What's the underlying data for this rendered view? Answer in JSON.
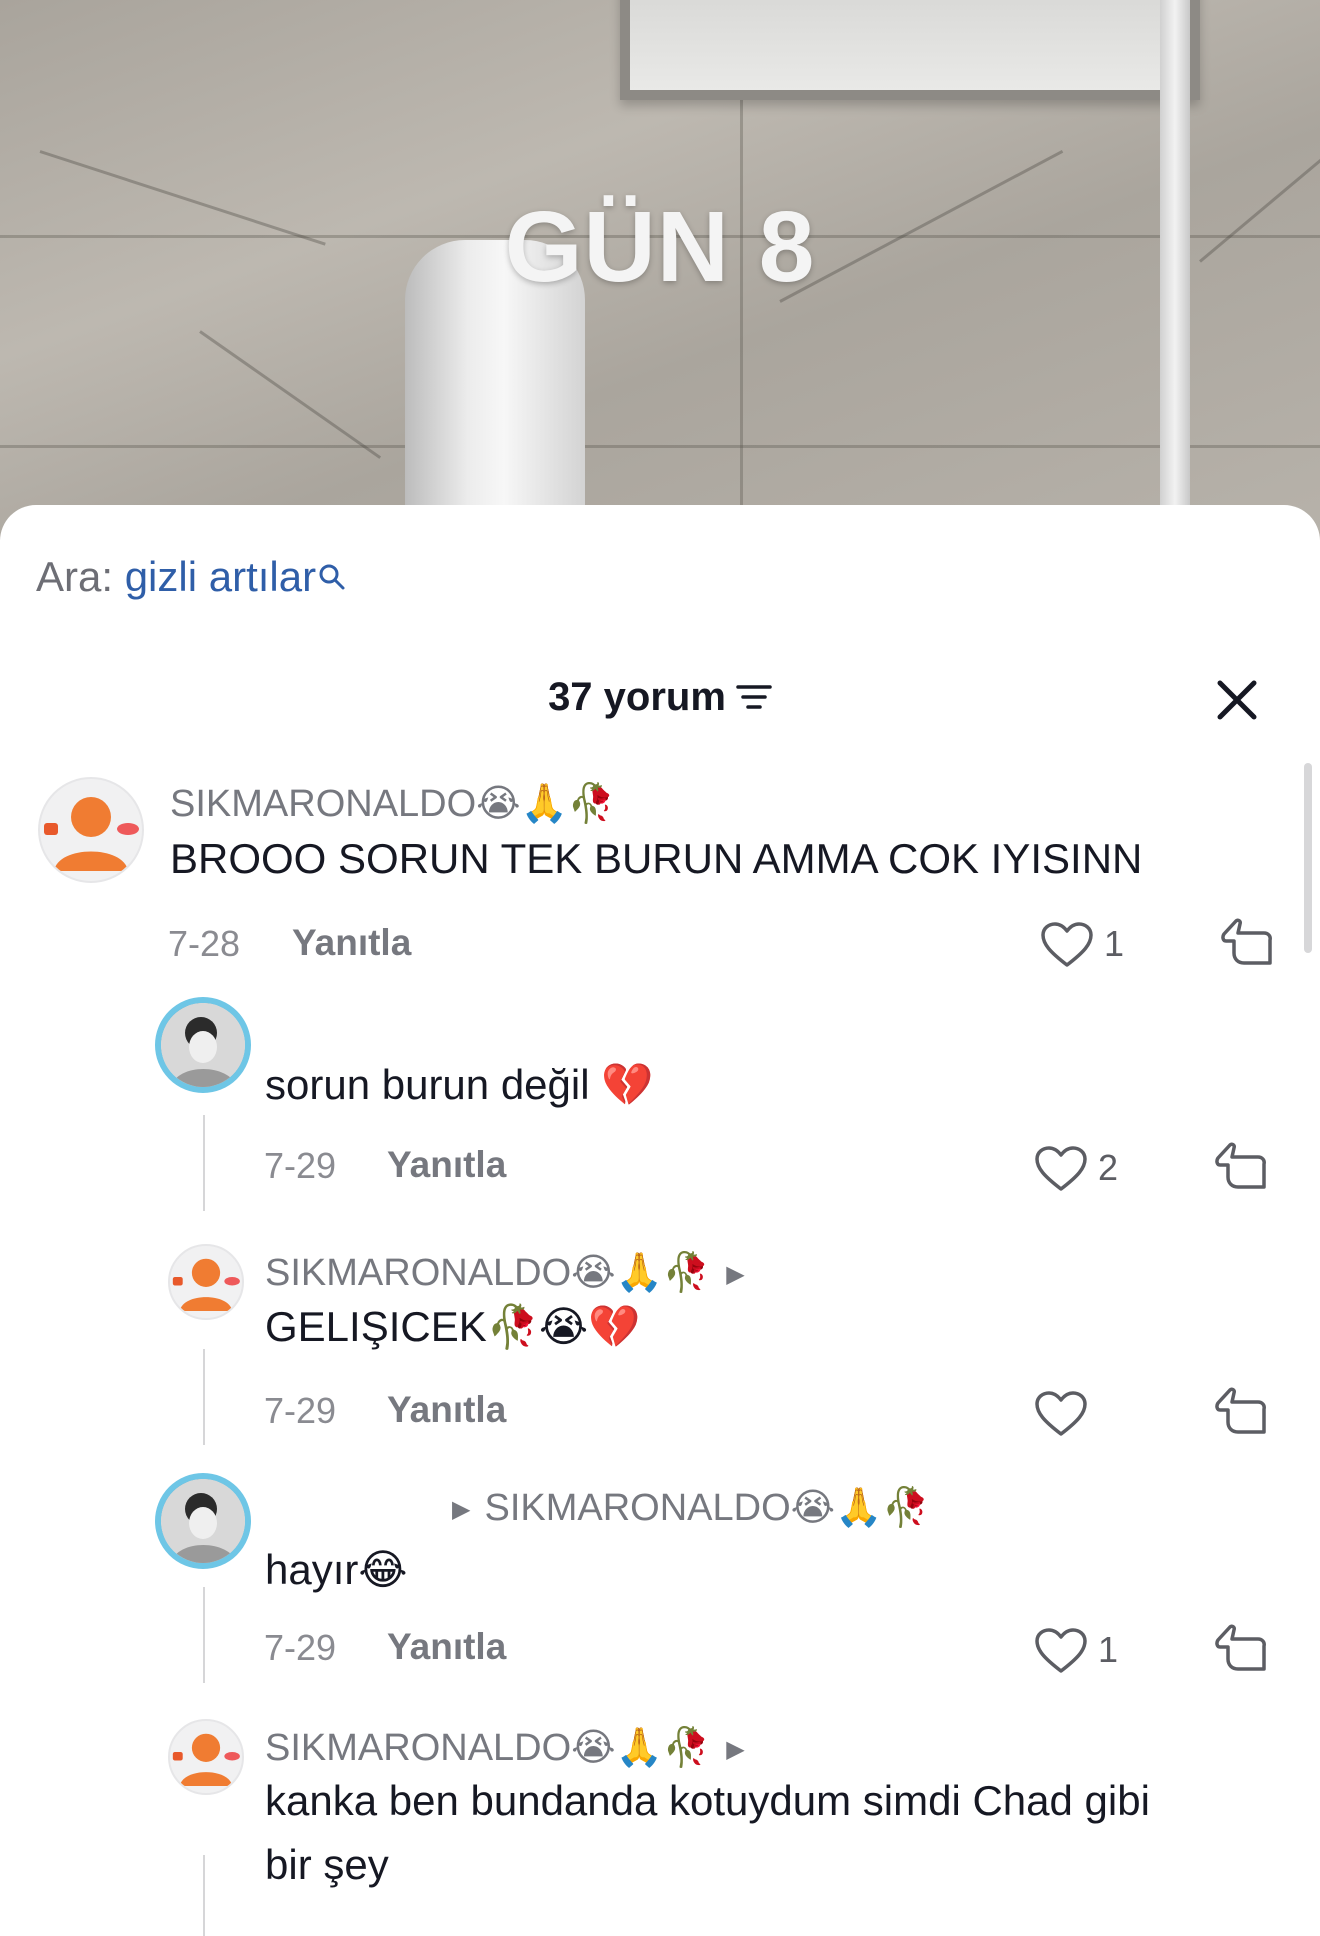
{
  "video": {
    "overlay_text": "GÜN 8"
  },
  "search": {
    "prefix": "Ara:",
    "term": "gizli artılar",
    "icon": "search-icon"
  },
  "header": {
    "count_label": "37 yorum",
    "filter_icon": "filter-icon",
    "close_icon": "close-icon"
  },
  "comments": [
    {
      "username": "SIKMARONALDO😭🙏🥀",
      "text": "BROOO SORUN TEK BURUN AMMA COK IYISINN",
      "date": "7-28",
      "reply_label": "Yanıtla",
      "likes": "1"
    },
    {
      "username": "",
      "text": "sorun burun değil 💔",
      "date": "7-29",
      "reply_label": "Yanıtla",
      "likes": "2"
    },
    {
      "username": "SIKMARONALDO😭🙏🥀",
      "text": "GELIŞICEK🥀😭💔",
      "date": "7-29",
      "reply_label": "Yanıtla",
      "likes": ""
    },
    {
      "username": "",
      "reply_to": "SIKMARONALDO😭🙏🥀",
      "text": "hayır😂",
      "date": "7-29",
      "reply_label": "Yanıtla",
      "likes": "1"
    },
    {
      "username": "SIKMARONALDO😭🙏🥀",
      "text_line1": "kanka ben bundanda kotuydum simdi Chad gibi",
      "text_line2": "bir şey"
    }
  ],
  "colors": {
    "link_blue": "#2f5ea8",
    "text_dark": "#161823",
    "muted": "#76787f",
    "avatar_orange": "#f07c32",
    "ring_blue": "#6ec6e6"
  }
}
